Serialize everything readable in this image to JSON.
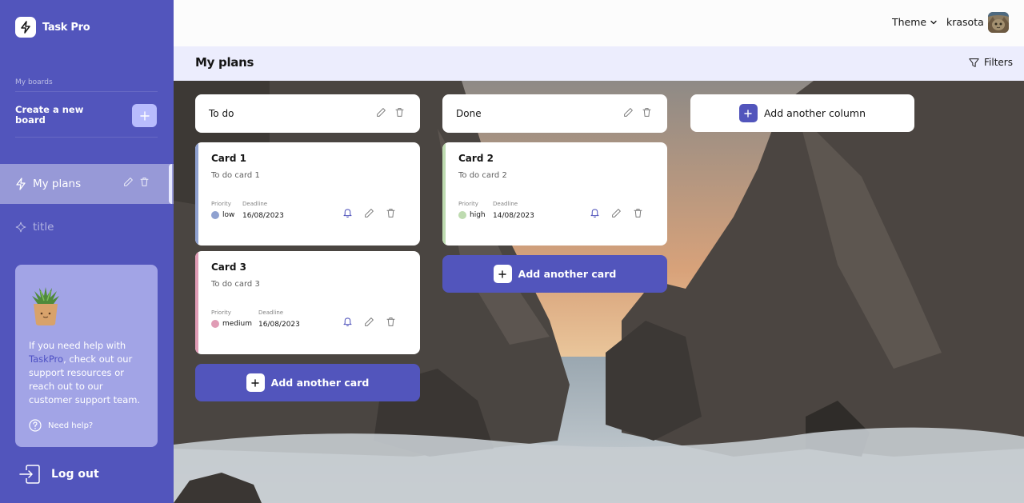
{
  "app": {
    "name": "Task Pro"
  },
  "sidebar": {
    "boards_label": "My boards",
    "create_board_label": "Create a new board",
    "boards": [
      {
        "name": "My plans",
        "active": true
      },
      {
        "name": "title",
        "active": false
      }
    ],
    "help": {
      "text_before": "If you need help with ",
      "brand": "TaskPro",
      "text_after": ", check out our support resources or reach out to our customer support team.",
      "link": "Need help?"
    },
    "logout_label": "Log out"
  },
  "header": {
    "theme_label": "Theme",
    "username": "krasota"
  },
  "board": {
    "title": "My plans",
    "filters_label": "Filters"
  },
  "columns": [
    {
      "title": "To do",
      "cards": [
        {
          "title": "Card 1",
          "description": "To do card 1",
          "priority_label": "Priority",
          "priority": "low",
          "deadline_label": "Deadline",
          "deadline": "16/08/2023"
        },
        {
          "title": "Card 3",
          "description": "To do card 3",
          "priority_label": "Priority",
          "priority": "medium",
          "deadline_label": "Deadline",
          "deadline": "16/08/2023"
        }
      ],
      "add_card_label": "Add another card"
    },
    {
      "title": "Done",
      "cards": [
        {
          "title": "Card 2",
          "description": "To do card 2",
          "priority_label": "Priority",
          "priority": "high",
          "deadline_label": "Deadline",
          "deadline": "14/08/2023"
        }
      ],
      "add_card_label": "Add another card"
    }
  ],
  "add_column_label": "Add another column",
  "colors": {
    "accent": "#5255bc",
    "priority_low": "#8fa1d0",
    "priority_medium": "#e09cb5",
    "priority_high": "#bedbb0"
  },
  "icons": {
    "logo": "lightning-icon",
    "board": "lightning-icon",
    "board_inactive": "sparkle-icon",
    "edit": "pencil-icon",
    "delete": "trash-icon",
    "bell": "bell-icon",
    "plus": "plus-icon",
    "help": "question-icon",
    "logout": "logout-icon",
    "filter": "filter-icon",
    "chevron": "chevron-down-icon"
  }
}
